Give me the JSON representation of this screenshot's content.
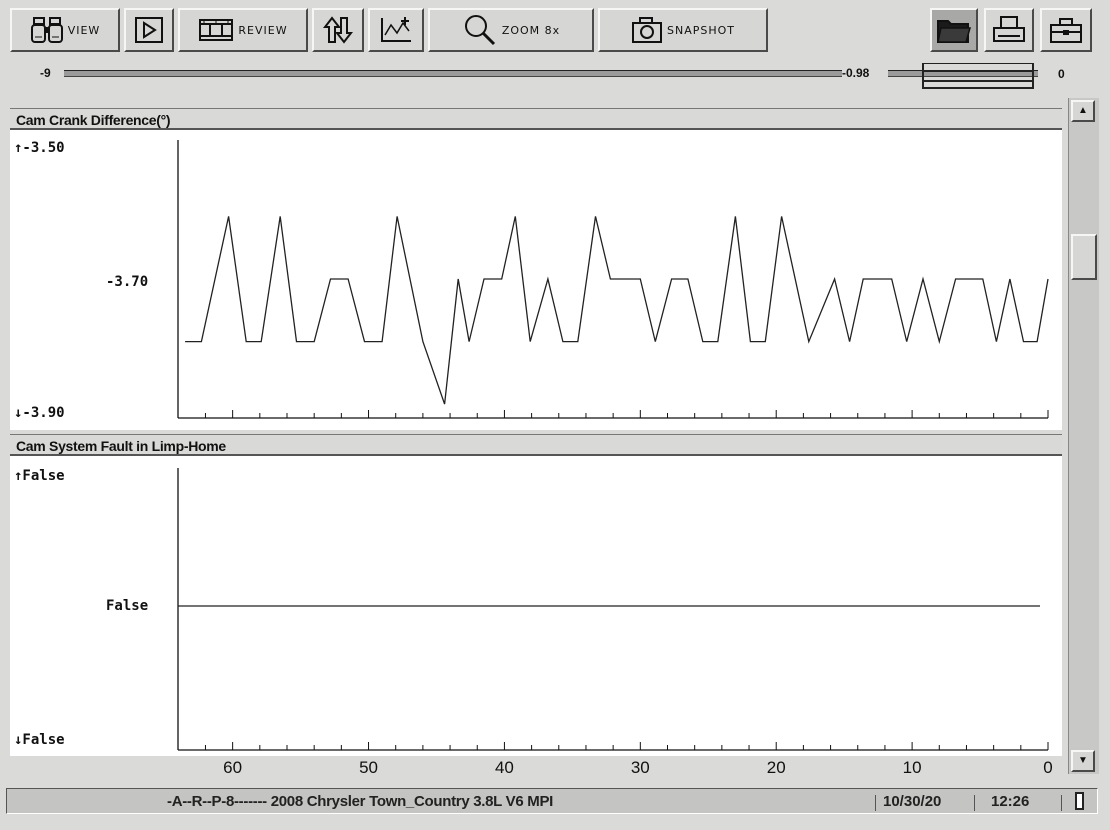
{
  "toolbar": {
    "view_label": "VIEW",
    "review_label": "REVIEW",
    "zoom_label": "ZOOM 8x",
    "snapshot_label": "SNAPSHOT"
  },
  "slider": {
    "left_value": "-9",
    "mid_value": "-0.98",
    "right_value": "0"
  },
  "panes": [
    {
      "title": "Cam Crank Difference(°)",
      "y_top": "↑-3.50",
      "y_mid": "-3.70",
      "y_bottom": "↓-3.90"
    },
    {
      "title": "Cam System Fault in Limp-Home",
      "y_top": "↑False",
      "y_mid": "False",
      "y_bottom": "↓False"
    }
  ],
  "x_axis": {
    "labels": [
      "60",
      "50",
      "40",
      "30",
      "20",
      "10",
      "0"
    ]
  },
  "status": {
    "vehicle": "-A--R--P-8------- 2008 Chrysler Town_Country 3.8L V6 MPI",
    "date": "10/30/20",
    "time": "12:26"
  },
  "chart_data": [
    {
      "type": "line",
      "title": "Cam Crank Difference(°)",
      "ylim": [
        -3.9,
        -3.5
      ],
      "xlim": [
        63,
        0
      ],
      "x": [
        63.5,
        62.3,
        60.3,
        59.0,
        57.9,
        56.5,
        55.3,
        54.0,
        52.8,
        51.5,
        50.3,
        49.0,
        47.9,
        46.0,
        44.4,
        43.4,
        42.6,
        41.5,
        40.2,
        39.2,
        38.1,
        36.8,
        35.7,
        34.6,
        33.3,
        32.2,
        31.1,
        30.0,
        28.9,
        27.7,
        26.5,
        25.4,
        24.3,
        23.0,
        21.9,
        20.8,
        19.6,
        17.6,
        15.7,
        14.6,
        13.6,
        12.5,
        11.5,
        10.4,
        9.2,
        8.0,
        6.8,
        5.8,
        4.8,
        3.8,
        2.8,
        1.8,
        0.8,
        0.0
      ],
      "y": [
        -3.79,
        -3.79,
        -3.61,
        -3.79,
        -3.79,
        -3.61,
        -3.79,
        -3.79,
        -3.7,
        -3.7,
        -3.79,
        -3.79,
        -3.61,
        -3.79,
        -3.88,
        -3.7,
        -3.79,
        -3.7,
        -3.7,
        -3.61,
        -3.79,
        -3.7,
        -3.79,
        -3.79,
        -3.61,
        -3.7,
        -3.7,
        -3.7,
        -3.79,
        -3.7,
        -3.7,
        -3.79,
        -3.79,
        -3.61,
        -3.79,
        -3.79,
        -3.61,
        -3.79,
        -3.7,
        -3.79,
        -3.7,
        -3.7,
        -3.7,
        -3.79,
        -3.7,
        -3.79,
        -3.7,
        -3.7,
        -3.7,
        -3.79,
        -3.7,
        -3.79,
        -3.79,
        -3.7
      ]
    },
    {
      "type": "line",
      "title": "Cam System Fault in Limp-Home",
      "values": [
        "False"
      ]
    }
  ]
}
